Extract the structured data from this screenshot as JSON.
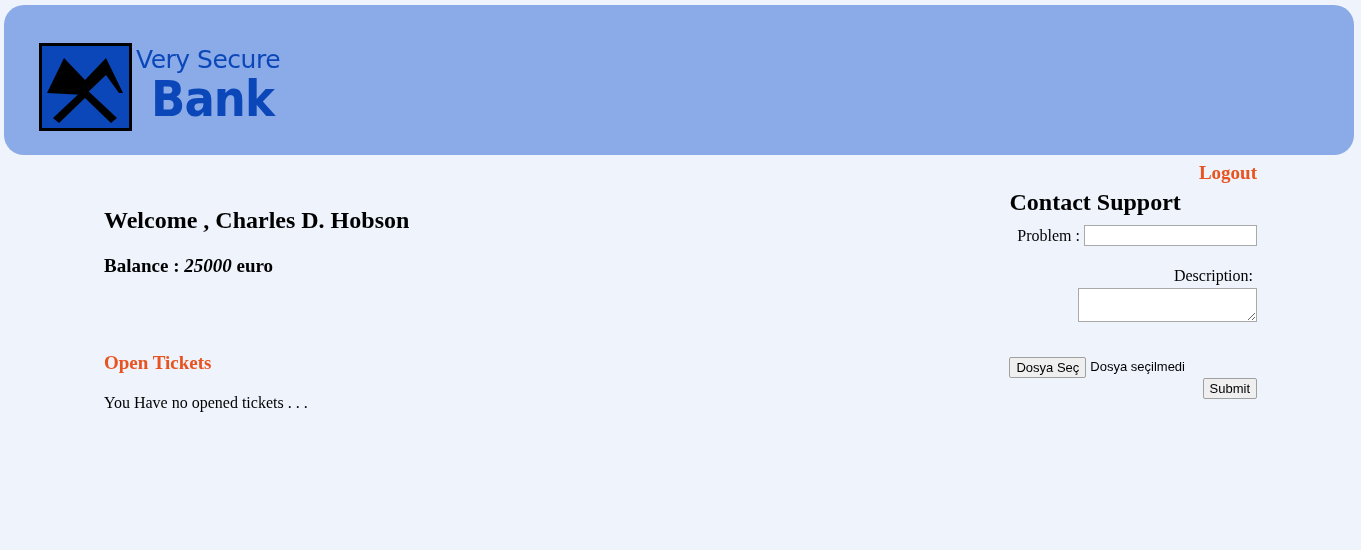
{
  "header": {
    "logo": {
      "line_1": "Very Secure",
      "line_2": "Bank"
    }
  },
  "logout": "Logout",
  "welcome": "Welcome , Charles D. Hobson",
  "balance": "Balance : *25000* euro",
  "open_tickets": {
    "title": "Open Tickets",
    "message": "You Have no opened tickets . . ."
  },
  "contact_support": {
    "title": "Contact Support",
    "problem_label": "Problem :",
    "description_label": "Description:",
    "file_button": "Dosya Seç",
    "file_status": "Dosya seçilmedi",
    "submit": "Submit"
  }
}
